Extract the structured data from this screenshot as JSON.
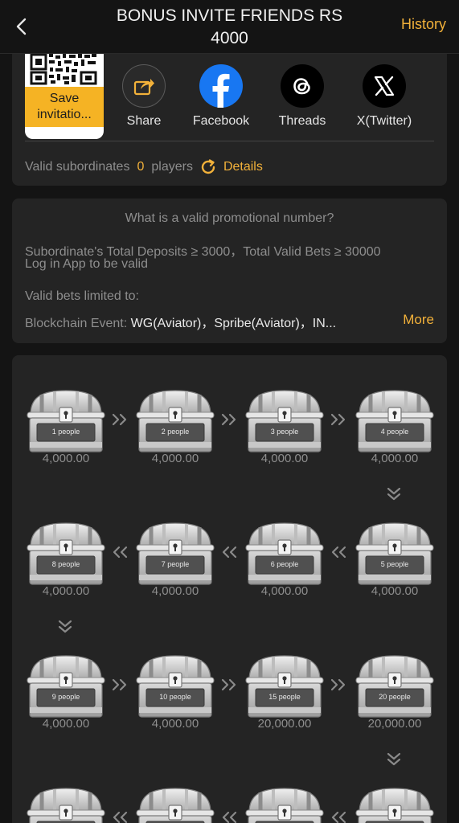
{
  "header": {
    "title_line1": "BONUS INVITE FRIENDS RS",
    "title_line2": "4000",
    "history_label": "History"
  },
  "share": {
    "save_label_line1": "Save",
    "save_label_line2": "invitatio...",
    "items": [
      {
        "label": "Share",
        "icon": "share-icon"
      },
      {
        "label": "Facebook",
        "icon": "facebook-icon"
      },
      {
        "label": "Threads",
        "icon": "threads-icon"
      },
      {
        "label": "X(Twitter)",
        "icon": "x-twitter-icon"
      }
    ],
    "valid_subordinates_label": "Valid subordinates",
    "valid_subordinates_count": "0",
    "players_label": "players",
    "details_label": "Details"
  },
  "rules": {
    "title": "What is a valid promotional number?",
    "deposits_text": "Subordinate's Total Deposits ≥ 3000，Total Valid Bets ≥ 30000",
    "login_text": "Log in App to be valid",
    "bets_limited_label": "Valid bets limited to:",
    "blockchain_label": "Blockchain Event:",
    "blockchain_value": "WG(Aviator)，Spribe(Aviator)，IN...",
    "more_label": "More"
  },
  "rewards": {
    "chests": [
      {
        "people": "1 people",
        "amount": "4,000.00"
      },
      {
        "people": "2 people",
        "amount": "4,000.00"
      },
      {
        "people": "3 people",
        "amount": "4,000.00"
      },
      {
        "people": "4 people",
        "amount": "4,000.00"
      },
      {
        "people": "5 people",
        "amount": "4,000.00"
      },
      {
        "people": "6 people",
        "amount": "4,000.00"
      },
      {
        "people": "7 people",
        "amount": "4,000.00"
      },
      {
        "people": "8 people",
        "amount": "4,000.00"
      },
      {
        "people": "9 people",
        "amount": "4,000.00"
      },
      {
        "people": "10 people",
        "amount": "4,000.00"
      },
      {
        "people": "15 people",
        "amount": "20,000.00"
      },
      {
        "people": "20 people",
        "amount": "20,000.00"
      }
    ]
  },
  "colors": {
    "accent": "#f2b13a",
    "save_button": "#f5b324",
    "card": "#242424",
    "background": "#141414",
    "facebook": "#1877f2"
  }
}
